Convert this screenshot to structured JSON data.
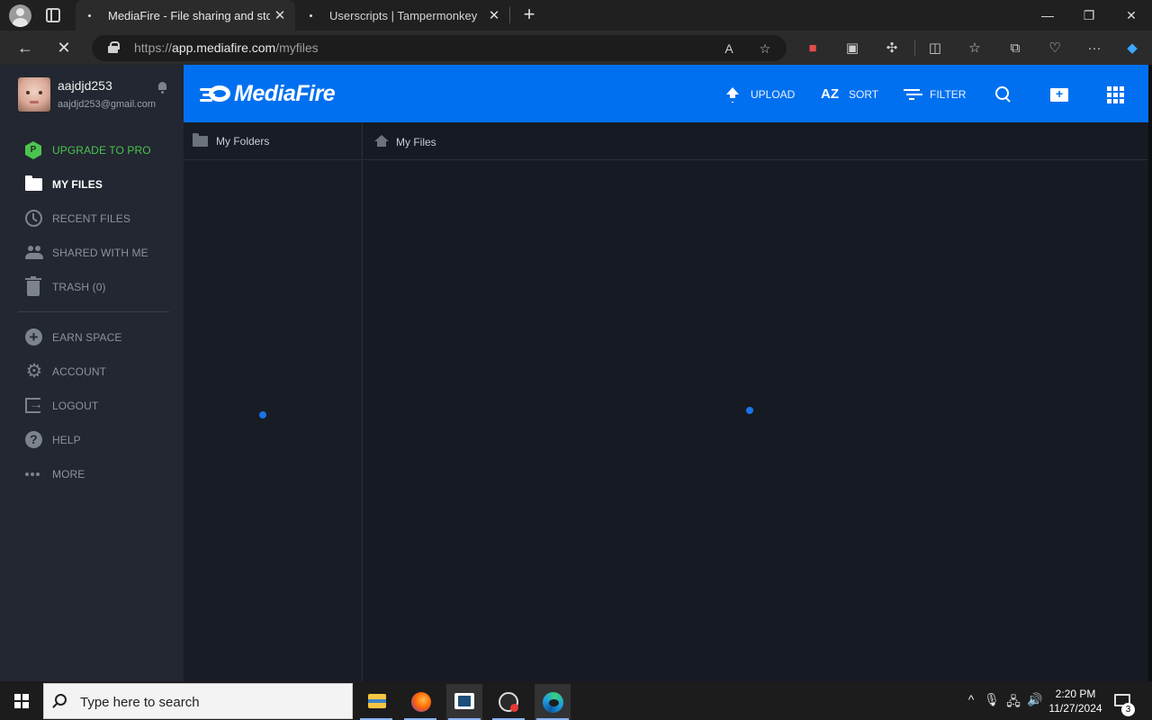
{
  "browser": {
    "tabs": [
      {
        "title": "MediaFire - File sharing and stora",
        "close": "✕"
      },
      {
        "title": "Userscripts | Tampermonkey",
        "close": "✕"
      }
    ],
    "new_tab": "+",
    "window_controls": {
      "minimize": "—",
      "restore": "❐",
      "close": "✕"
    },
    "url": {
      "scheme": "https://",
      "host": "app.mediafire.com",
      "path": "/myfiles"
    },
    "back": "←",
    "stop": "✕"
  },
  "user": {
    "name": "aajdjd253",
    "email": "aajdjd253@gmail.com"
  },
  "sidebar": {
    "items": [
      {
        "label": "UPGRADE TO PRO",
        "icon": "pro-hexagon-icon",
        "badge": "P"
      },
      {
        "label": "MY FILES",
        "icon": "folder-icon"
      },
      {
        "label": "RECENT FILES",
        "icon": "clock-icon"
      },
      {
        "label": "SHARED WITH ME",
        "icon": "people-icon"
      },
      {
        "label": "TRASH (0)",
        "icon": "trash-icon"
      },
      {
        "label": "EARN SPACE",
        "icon": "plus-circle-icon"
      },
      {
        "label": "ACCOUNT",
        "icon": "gear-icon"
      },
      {
        "label": "LOGOUT",
        "icon": "logout-icon"
      },
      {
        "label": "HELP",
        "icon": "help-icon"
      },
      {
        "label": "MORE",
        "icon": "more-icon"
      }
    ]
  },
  "toolbar": {
    "logo": "MediaFire",
    "upload": "UPLOAD",
    "sort_icon": "AZ",
    "sort": "SORT",
    "filter": "FILTER"
  },
  "panes": {
    "folders_title": "My Folders",
    "files_title": "My Files"
  },
  "taskbar": {
    "search_placeholder": "Type here to search",
    "time": "2:20 PM",
    "date": "11/27/2024",
    "notification_count": "3"
  },
  "colors": {
    "brand_blue": "#0070f0",
    "upgrade_green": "#4bc44f",
    "sidebar_bg": "#222731",
    "content_bg": "#161a22"
  }
}
